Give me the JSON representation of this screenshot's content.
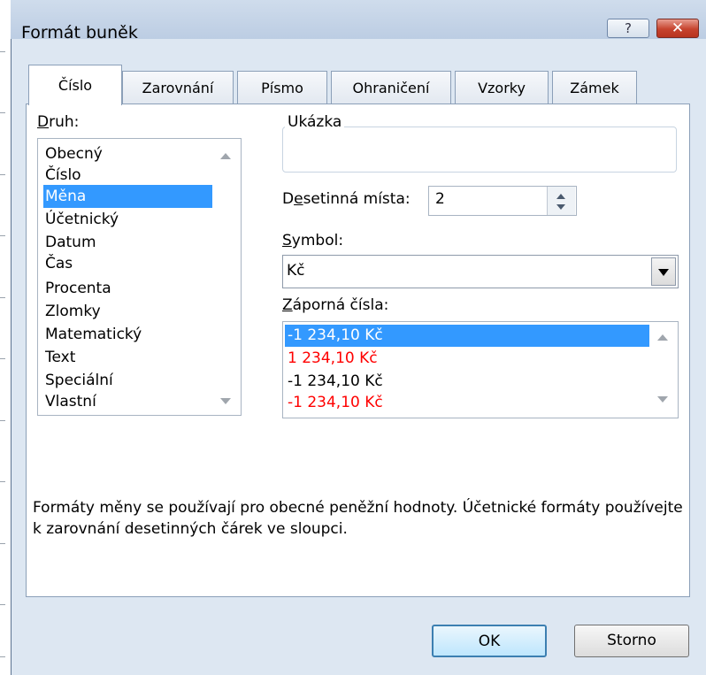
{
  "window": {
    "title": "Formát buněk",
    "help_label": "?",
    "close_label": "✕"
  },
  "tabs": [
    {
      "label": "Číslo",
      "active": true
    },
    {
      "label": "Zarovnání"
    },
    {
      "label": "Písmo"
    },
    {
      "label": "Ohraničení"
    },
    {
      "label": "Vzorky"
    },
    {
      "label": "Zámek"
    }
  ],
  "category": {
    "label_underlined": "D",
    "label_rest": "ruh:",
    "items": [
      "Obecný",
      "Číslo",
      "Měna",
      "Účetnický",
      "Datum",
      "Čas",
      "Procenta",
      "Zlomky",
      "Matematický",
      "Text",
      "Speciální",
      "Vlastní"
    ],
    "selected": "Měna"
  },
  "sample": {
    "label": "Ukázka",
    "value": ""
  },
  "decimal": {
    "label_pre": "D",
    "label_underlined": "e",
    "label_rest": "setinná místa:",
    "value": "2"
  },
  "symbol": {
    "label_underlined": "S",
    "label_rest": "ymbol:",
    "value": "Kč"
  },
  "negative": {
    "label_underlined": "Z",
    "label_rest": "áporná čísla:",
    "items": [
      "-1 234,10 Kč",
      "1 234,10 Kč",
      "-1 234,10 Kč",
      "-1 234,10 Kč"
    ],
    "selected_index": 0
  },
  "description": "Formáty měny se používají pro obecné peněžní hodnoty. Účetnické formáty používejte k zarovnání desetinných čárek ve sloupci.",
  "buttons": {
    "ok": "OK",
    "cancel": "Storno"
  },
  "colors": {
    "selection": "#3399ff",
    "negative_red": "#ff0000",
    "dialog_bg": "#dde7f2"
  }
}
